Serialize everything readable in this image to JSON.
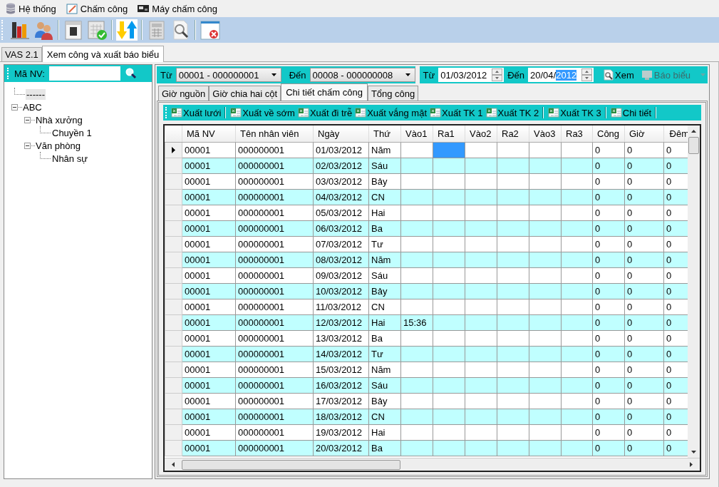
{
  "menu": [
    {
      "label": "Hệ thống",
      "kind": "database"
    },
    {
      "label": "Chấm công",
      "kind": "edit"
    },
    {
      "label": "Máy chấm công",
      "kind": "device"
    }
  ],
  "doc_tabs": [
    {
      "label": "VAS 2.1",
      "selected": false
    },
    {
      "label": "Xem công và xuất báo biểu",
      "selected": true
    }
  ],
  "employee_search": {
    "label": "Mã NV:"
  },
  "tree": [
    {
      "label": "------",
      "selected": true
    },
    {
      "label": "ABC",
      "selected": false,
      "expanded": true,
      "children": [
        {
          "label": "Nhà xưởng",
          "selected": false,
          "expanded": true,
          "children": [
            {
              "label": "Chuyền 1",
              "selected": false
            }
          ]
        },
        {
          "label": "Văn phòng",
          "selected": false,
          "expanded": true,
          "children": [
            {
              "label": "Nhân sự",
              "selected": false
            }
          ]
        }
      ]
    }
  ],
  "filter": {
    "from_label": "Từ",
    "from_employee": "00001 - 000000001",
    "to_label": "Đến",
    "to_employee": "00008 - 000000008",
    "date_from_label": "Từ",
    "date_from": "01/03/2012",
    "date_to_label": "Đến",
    "date_to_unselected": "20/04/",
    "date_to_selected": "2012",
    "view_button": {
      "label": "Xem",
      "disabled": false
    },
    "report_button": {
      "label": "Báo biểu",
      "disabled": true
    }
  },
  "sub_tabs": [
    {
      "label": "Giờ nguồn",
      "selected": false
    },
    {
      "label": "Giờ chia hai cột",
      "selected": false
    },
    {
      "label": "Chi tiết chấm công",
      "selected": true
    },
    {
      "label": "Tổng công",
      "selected": false
    }
  ],
  "export_buttons": [
    {
      "label": "Xuất lưới",
      "separator_after": true
    },
    {
      "label": "Xuất về sớm",
      "separator_after": false
    },
    {
      "label": "Xuất đi trễ",
      "separator_after": false
    },
    {
      "label": "Xuất vắng mặt",
      "separator_after": false
    },
    {
      "label": "Xuất TK 1",
      "separator_after": false
    },
    {
      "label": "Xuất TK 2",
      "separator_after": true
    },
    {
      "label": "Xuất TK 3",
      "separator_after": true
    },
    {
      "label": "Chi tiết",
      "separator_after": true
    }
  ],
  "table": {
    "columns": [
      "Mã NV",
      "Tên nhân viên",
      "Ngày",
      "Thứ",
      "Vào1",
      "Ra1",
      "Vào2",
      "Ra2",
      "Vào3",
      "Ra3",
      "Công",
      "Giờ",
      "Đêm"
    ],
    "rows": [
      {
        "current": true,
        "cells": [
          "00001",
          "000000001",
          "01/03/2012",
          "Năm",
          null,
          {
            "selected": true
          },
          null,
          null,
          null,
          null,
          "0",
          "0",
          "0"
        ]
      },
      {
        "current": false,
        "cells": [
          "00001",
          "000000001",
          "02/03/2012",
          "Sáu",
          null,
          null,
          null,
          null,
          null,
          null,
          "0",
          "0",
          "0"
        ]
      },
      {
        "current": false,
        "cells": [
          "00001",
          "000000001",
          "03/03/2012",
          "Bảy",
          null,
          null,
          null,
          null,
          null,
          null,
          "0",
          "0",
          "0"
        ]
      },
      {
        "current": false,
        "cells": [
          "00001",
          "000000001",
          "04/03/2012",
          "CN",
          null,
          null,
          null,
          null,
          null,
          null,
          "0",
          "0",
          "0"
        ]
      },
      {
        "current": false,
        "cells": [
          "00001",
          "000000001",
          "05/03/2012",
          "Hai",
          null,
          null,
          null,
          null,
          null,
          null,
          "0",
          "0",
          "0"
        ]
      },
      {
        "current": false,
        "cells": [
          "00001",
          "000000001",
          "06/03/2012",
          "Ba",
          null,
          null,
          null,
          null,
          null,
          null,
          "0",
          "0",
          "0"
        ]
      },
      {
        "current": false,
        "cells": [
          "00001",
          "000000001",
          "07/03/2012",
          "Tư",
          null,
          null,
          null,
          null,
          null,
          null,
          "0",
          "0",
          "0"
        ]
      },
      {
        "current": false,
        "cells": [
          "00001",
          "000000001",
          "08/03/2012",
          "Năm",
          null,
          null,
          null,
          null,
          null,
          null,
          "0",
          "0",
          "0"
        ]
      },
      {
        "current": false,
        "cells": [
          "00001",
          "000000001",
          "09/03/2012",
          "Sáu",
          null,
          null,
          null,
          null,
          null,
          null,
          "0",
          "0",
          "0"
        ]
      },
      {
        "current": false,
        "cells": [
          "00001",
          "000000001",
          "10/03/2012",
          "Bảy",
          null,
          null,
          null,
          null,
          null,
          null,
          "0",
          "0",
          "0"
        ]
      },
      {
        "current": false,
        "cells": [
          "00001",
          "000000001",
          "11/03/2012",
          "CN",
          null,
          null,
          null,
          null,
          null,
          null,
          "0",
          "0",
          "0"
        ]
      },
      {
        "current": false,
        "cells": [
          "00001",
          "000000001",
          "12/03/2012",
          "Hai",
          "15:36",
          null,
          null,
          null,
          null,
          null,
          "0",
          "0",
          "0"
        ]
      },
      {
        "current": false,
        "cells": [
          "00001",
          "000000001",
          "13/03/2012",
          "Ba",
          null,
          null,
          null,
          null,
          null,
          null,
          "0",
          "0",
          "0"
        ]
      },
      {
        "current": false,
        "cells": [
          "00001",
          "000000001",
          "14/03/2012",
          "Tư",
          null,
          null,
          null,
          null,
          null,
          null,
          "0",
          "0",
          "0"
        ]
      },
      {
        "current": false,
        "cells": [
          "00001",
          "000000001",
          "15/03/2012",
          "Năm",
          null,
          null,
          null,
          null,
          null,
          null,
          "0",
          "0",
          "0"
        ]
      },
      {
        "current": false,
        "cells": [
          "00001",
          "000000001",
          "16/03/2012",
          "Sáu",
          null,
          null,
          null,
          null,
          null,
          null,
          "0",
          "0",
          "0"
        ]
      },
      {
        "current": false,
        "cells": [
          "00001",
          "000000001",
          "17/03/2012",
          "Bảy",
          null,
          null,
          null,
          null,
          null,
          null,
          "0",
          "0",
          "0"
        ]
      },
      {
        "current": false,
        "cells": [
          "00001",
          "000000001",
          "18/03/2012",
          "CN",
          null,
          null,
          null,
          null,
          null,
          null,
          "0",
          "0",
          "0"
        ]
      },
      {
        "current": false,
        "cells": [
          "00001",
          "000000001",
          "19/03/2012",
          "Hai",
          null,
          null,
          null,
          null,
          null,
          null,
          "0",
          "0",
          "0"
        ]
      },
      {
        "current": false,
        "cells": [
          "00001",
          "000000001",
          "20/03/2012",
          "Ba",
          null,
          null,
          null,
          null,
          null,
          null,
          "0",
          "0",
          "0"
        ]
      }
    ]
  }
}
